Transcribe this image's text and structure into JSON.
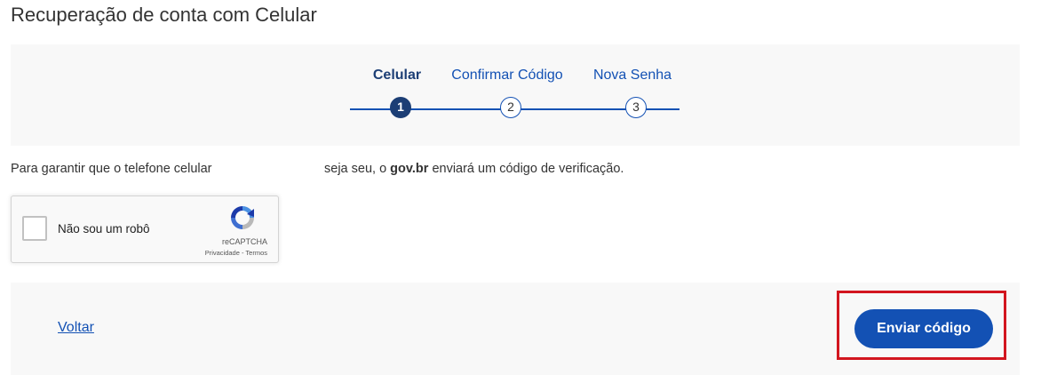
{
  "page": {
    "title": "Recuperação de conta com Celular"
  },
  "stepper": {
    "steps": [
      {
        "label": "Celular",
        "number": "1",
        "active": true
      },
      {
        "label": "Confirmar Código",
        "number": "2",
        "active": false
      },
      {
        "label": "Nova Senha",
        "number": "3",
        "active": false
      }
    ]
  },
  "info": {
    "part1": "Para garantir que o telefone celular",
    "part2": "seja seu, o",
    "brand": "gov.br",
    "part3": "enviará um código de verificação."
  },
  "captcha": {
    "label": "Não sou um robô",
    "brand": "reCAPTCHA",
    "links": "Privacidade - Termos",
    "logo_icon": "recaptcha-icon"
  },
  "footer": {
    "back_label": "Voltar",
    "send_label": "Enviar código"
  },
  "colors": {
    "primary": "#1351b4",
    "active_step": "#1c3e75",
    "highlight": "#d2161f",
    "panel_bg": "#f8f8f8"
  }
}
